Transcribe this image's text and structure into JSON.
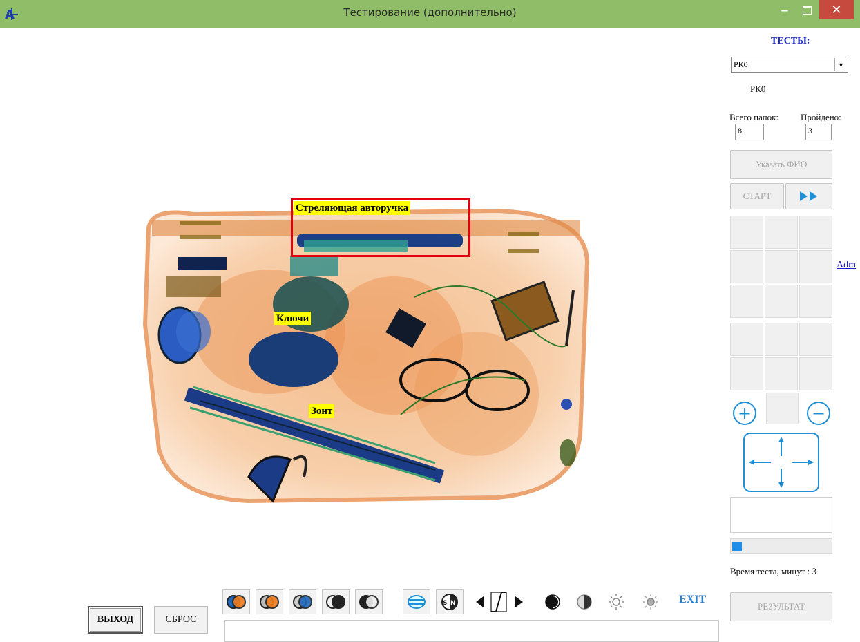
{
  "window": {
    "title": "Тестирование (дополнительно)"
  },
  "labels": {
    "pen": "Стреляющая авторучка",
    "keys": "Ключи",
    "umbrella": "Зонт"
  },
  "panel": {
    "title": "ТЕСТЫ:",
    "test_selected": "РК0",
    "test_name": "РК0",
    "total_folders_label": "Всего папок:",
    "passed_label": "Пройдено:",
    "total_folders_value": "8",
    "passed_value": "3",
    "specify_name_button": "Указать ФИО",
    "start_button": "СТАРТ",
    "adm_link": "Adm",
    "progress_fraction": 0.1,
    "time_label": "Время теста, минут : 3",
    "result_button": "РЕЗУЛЬТАТ"
  },
  "toolbar": {
    "exit_label": "EXIT",
    "icons": [
      "color-mode-1-icon",
      "color-mode-2-icon",
      "color-mode-3-icon",
      "color-mode-4-icon",
      "color-mode-5-icon",
      "material-filter-icon",
      "sen-icon",
      "contrast-prev-icon",
      "gamma-curve-icon",
      "contrast-next-icon",
      "contrast-high-icon",
      "contrast-low-icon",
      "brightness-up-icon",
      "brightness-down-icon"
    ]
  },
  "buttons": {
    "exit": "ВЫХОД",
    "reset": "СБРОС"
  },
  "colors": {
    "titlebar": "#90bd68",
    "accent_blue": "#1f8fd6",
    "close_red": "#c74a3e",
    "label_bg": "#ffff00",
    "highlight_red": "#e2000f"
  }
}
